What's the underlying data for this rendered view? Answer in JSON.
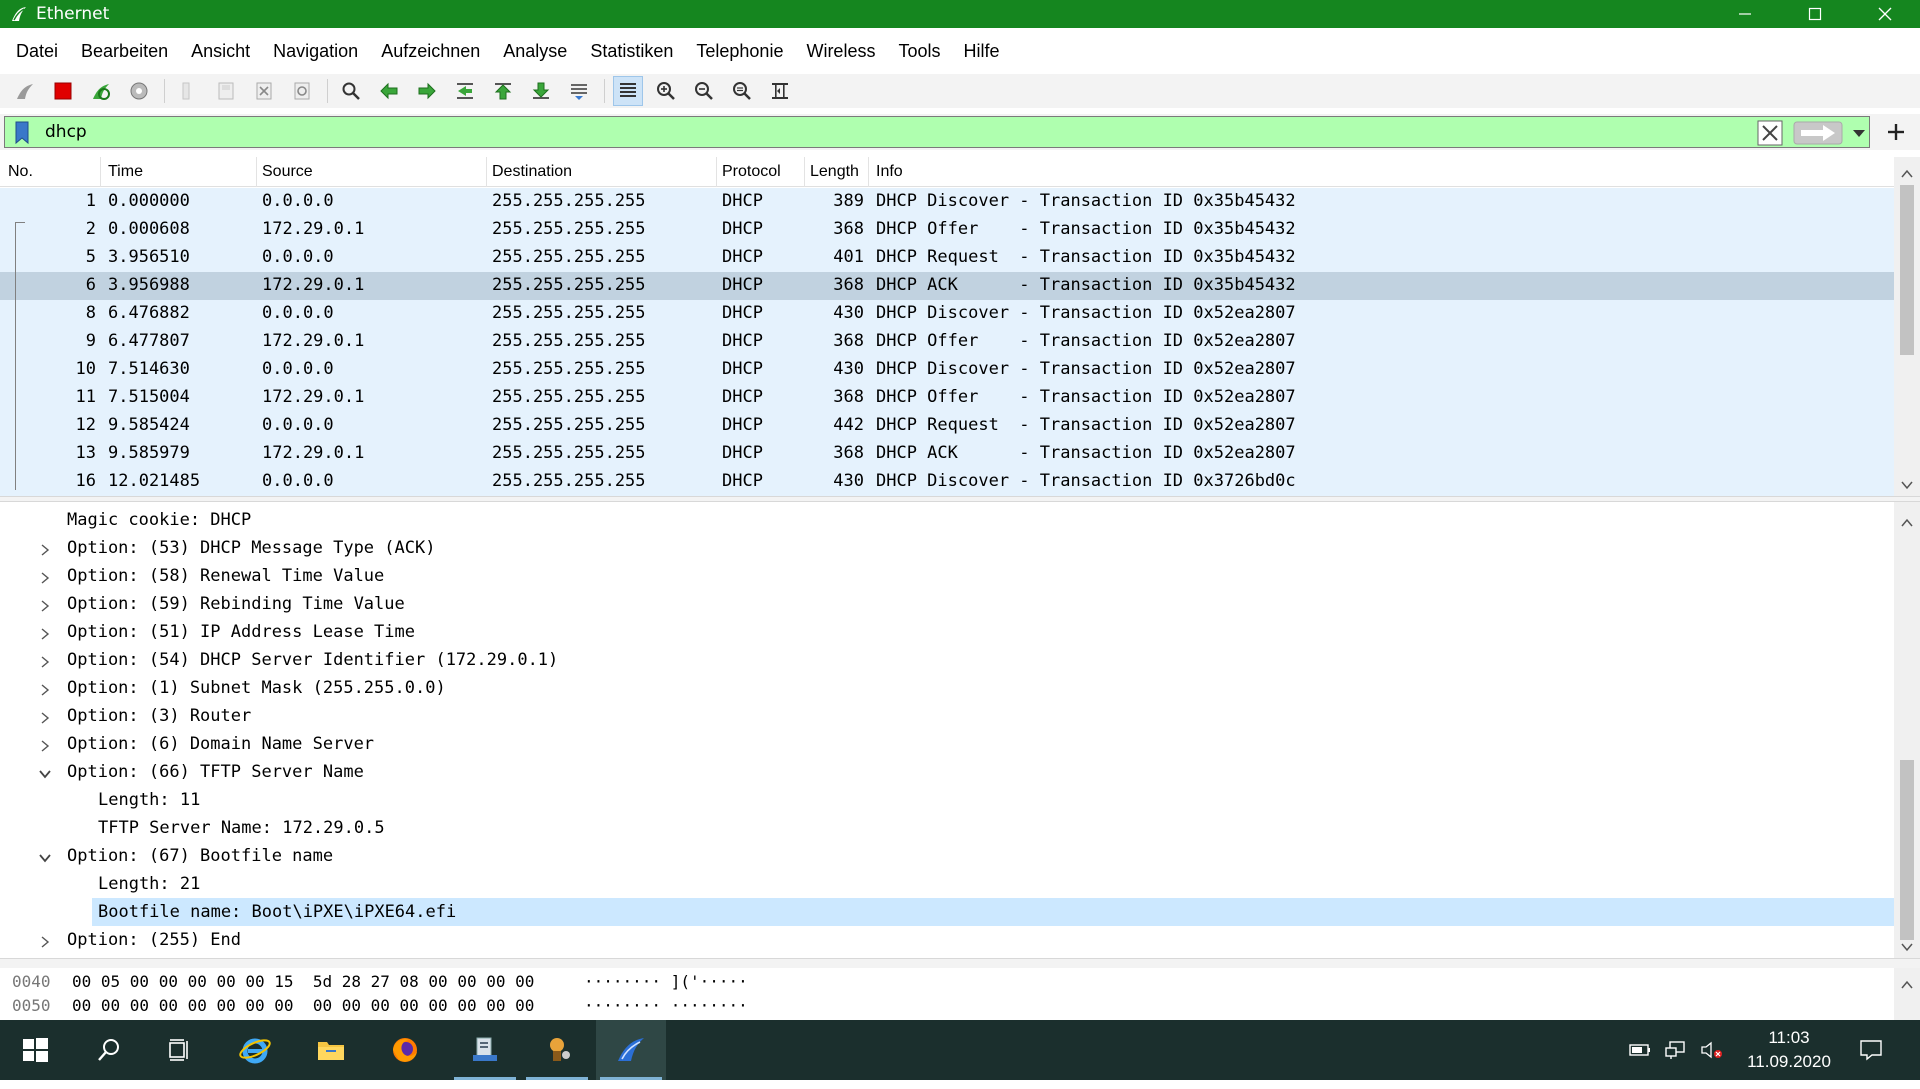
{
  "window": {
    "title": "Ethernet"
  },
  "menu": [
    "Datei",
    "Bearbeiten",
    "Ansicht",
    "Navigation",
    "Aufzeichnen",
    "Analyse",
    "Statistiken",
    "Telephonie",
    "Wireless",
    "Tools",
    "Hilfe"
  ],
  "filter": {
    "value": "dhcp"
  },
  "packet_list": {
    "columns": [
      "No.",
      "Time",
      "Source",
      "Destination",
      "Protocol",
      "Length",
      "Info"
    ],
    "rows": [
      {
        "no": "1",
        "time": "0.000000",
        "src": "0.0.0.0",
        "dst": "255.255.255.255",
        "proto": "DHCP",
        "len": "389",
        "info": "DHCP Discover - Transaction ID 0x35b45432"
      },
      {
        "no": "2",
        "time": "0.000608",
        "src": "172.29.0.1",
        "dst": "255.255.255.255",
        "proto": "DHCP",
        "len": "368",
        "info": "DHCP Offer    - Transaction ID 0x35b45432"
      },
      {
        "no": "5",
        "time": "3.956510",
        "src": "0.0.0.0",
        "dst": "255.255.255.255",
        "proto": "DHCP",
        "len": "401",
        "info": "DHCP Request  - Transaction ID 0x35b45432"
      },
      {
        "no": "6",
        "time": "3.956988",
        "src": "172.29.0.1",
        "dst": "255.255.255.255",
        "proto": "DHCP",
        "len": "368",
        "info": "DHCP ACK      - Transaction ID 0x35b45432"
      },
      {
        "no": "8",
        "time": "6.476882",
        "src": "0.0.0.0",
        "dst": "255.255.255.255",
        "proto": "DHCP",
        "len": "430",
        "info": "DHCP Discover - Transaction ID 0x52ea2807"
      },
      {
        "no": "9",
        "time": "6.477807",
        "src": "172.29.0.1",
        "dst": "255.255.255.255",
        "proto": "DHCP",
        "len": "368",
        "info": "DHCP Offer    - Transaction ID 0x52ea2807"
      },
      {
        "no": "10",
        "time": "7.514630",
        "src": "0.0.0.0",
        "dst": "255.255.255.255",
        "proto": "DHCP",
        "len": "430",
        "info": "DHCP Discover - Transaction ID 0x52ea2807"
      },
      {
        "no": "11",
        "time": "7.515004",
        "src": "172.29.0.1",
        "dst": "255.255.255.255",
        "proto": "DHCP",
        "len": "368",
        "info": "DHCP Offer    - Transaction ID 0x52ea2807"
      },
      {
        "no": "12",
        "time": "9.585424",
        "src": "0.0.0.0",
        "dst": "255.255.255.255",
        "proto": "DHCP",
        "len": "442",
        "info": "DHCP Request  - Transaction ID 0x52ea2807"
      },
      {
        "no": "13",
        "time": "9.585979",
        "src": "172.29.0.1",
        "dst": "255.255.255.255",
        "proto": "DHCP",
        "len": "368",
        "info": "DHCP ACK      - Transaction ID 0x52ea2807"
      },
      {
        "no": "16",
        "time": "12.021485",
        "src": "0.0.0.0",
        "dst": "255.255.255.255",
        "proto": "DHCP",
        "len": "430",
        "info": "DHCP Discover - Transaction ID 0x3726bd0c"
      }
    ]
  },
  "details": [
    {
      "text": "Magic cookie: DHCP",
      "state": "none",
      "indent": 0
    },
    {
      "text": "Option: (53) DHCP Message Type (ACK)",
      "state": "collapsed",
      "indent": 0
    },
    {
      "text": "Option: (58) Renewal Time Value",
      "state": "collapsed",
      "indent": 0
    },
    {
      "text": "Option: (59) Rebinding Time Value",
      "state": "collapsed",
      "indent": 0
    },
    {
      "text": "Option: (51) IP Address Lease Time",
      "state": "collapsed",
      "indent": 0
    },
    {
      "text": "Option: (54) DHCP Server Identifier (172.29.0.1)",
      "state": "collapsed",
      "indent": 0
    },
    {
      "text": "Option: (1) Subnet Mask (255.255.0.0)",
      "state": "collapsed",
      "indent": 0
    },
    {
      "text": "Option: (3) Router",
      "state": "collapsed",
      "indent": 0
    },
    {
      "text": "Option: (6) Domain Name Server",
      "state": "collapsed",
      "indent": 0
    },
    {
      "text": "Option: (66) TFTP Server Name",
      "state": "expanded",
      "indent": 0
    },
    {
      "text": "Length: 11",
      "state": "none",
      "indent": 1
    },
    {
      "text": "TFTP Server Name: 172.29.0.5",
      "state": "none",
      "indent": 1
    },
    {
      "text": "Option: (67) Bootfile name",
      "state": "expanded",
      "indent": 0
    },
    {
      "text": "Length: 21",
      "state": "none",
      "indent": 1
    },
    {
      "text": "Bootfile name: Boot\\iPXE\\iPXE64.efi",
      "state": "none",
      "indent": 1
    },
    {
      "text": "Option: (255) End",
      "state": "collapsed",
      "indent": 0
    }
  ],
  "bytes": [
    {
      "offset": "0040",
      "hex": "00 05 00 00 00 00 00 15  5d 28 27 08 00 00 00 00",
      "ascii": "········ ]('·····"
    },
    {
      "offset": "0050",
      "hex": "00 00 00 00 00 00 00 00  00 00 00 00 00 00 00 00",
      "ascii": "········ ········"
    }
  ],
  "taskbar": {
    "time": "11:03",
    "date": "11.09.2020"
  },
  "colors": {
    "titlebar": "#15861f",
    "filter_ok": "#afffaf",
    "row_bg": "#e5f2fd",
    "row_selected": "#c1d2e0",
    "detail_highlight": "#cce8ff",
    "taskbar": "#1b2f2d"
  }
}
